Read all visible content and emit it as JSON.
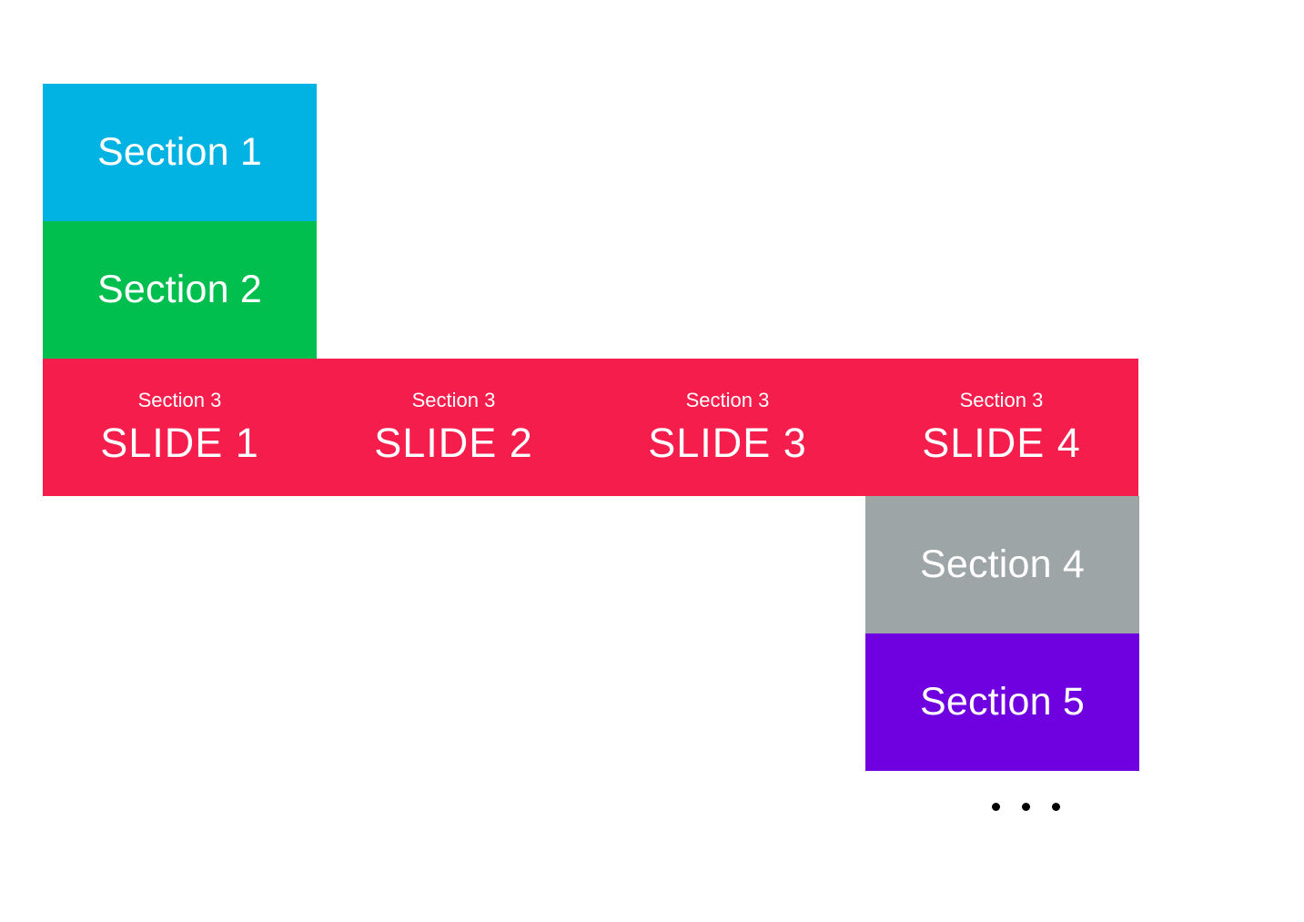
{
  "sections": {
    "s1": {
      "title": "Section 1"
    },
    "s2": {
      "title": "Section 2"
    },
    "s3": {
      "label": "Section 3",
      "slides": [
        {
          "label": "Section 3",
          "title": "SLIDE 1"
        },
        {
          "label": "Section 3",
          "title": "SLIDE 2"
        },
        {
          "label": "Section 3",
          "title": "SLIDE 3"
        },
        {
          "label": "Section 3",
          "title": "SLIDE 4"
        }
      ]
    },
    "s4": {
      "title": "Section 4"
    },
    "s5": {
      "title": "Section 5"
    }
  },
  "pagination": {
    "dot_count": 3
  }
}
